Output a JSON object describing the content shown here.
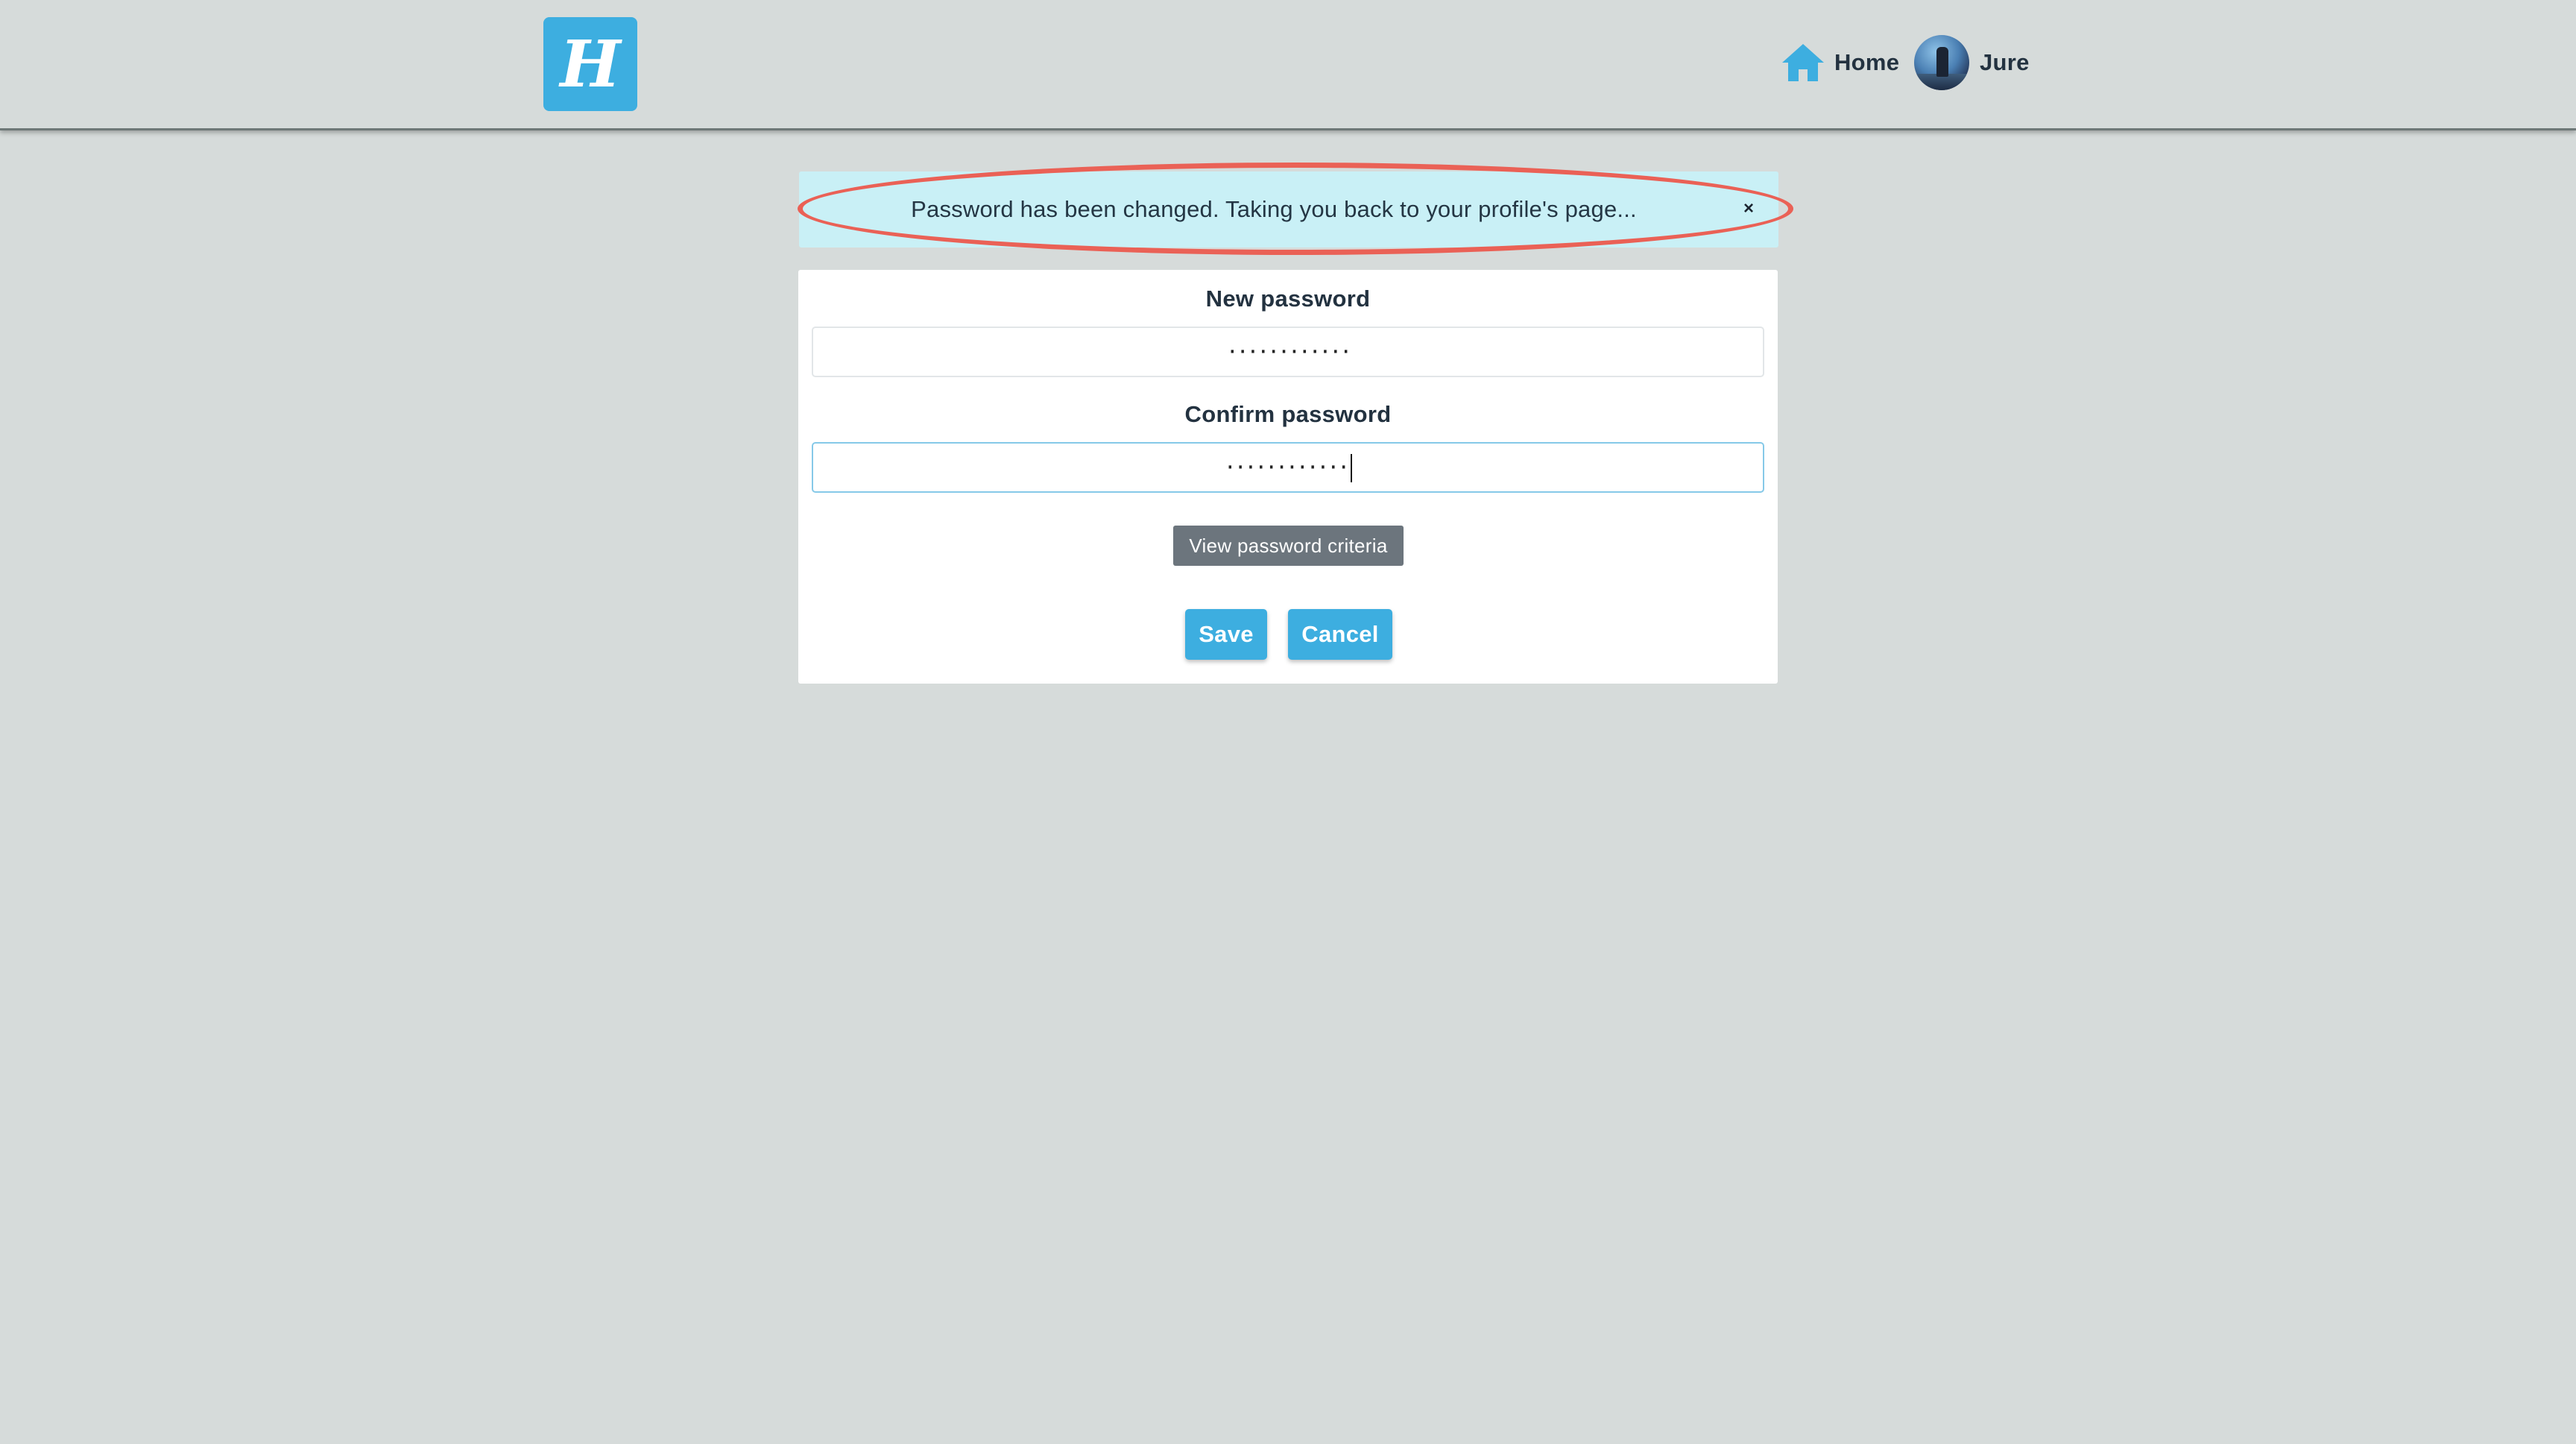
{
  "header": {
    "logo_letter": "H",
    "nav": {
      "home_label": "Home",
      "user_name": "Jure"
    }
  },
  "alert": {
    "message": "Password has been changed. Taking you back to your profile's page...",
    "close_symbol": "×"
  },
  "form": {
    "new_password": {
      "label": "New password",
      "value": "············"
    },
    "confirm_password": {
      "label": "Confirm password",
      "value": "············"
    },
    "criteria_button_label": "View password criteria",
    "save_label": "Save",
    "cancel_label": "Cancel"
  },
  "colors": {
    "page_background": "#d6dbda",
    "accent": "#3daee0",
    "alert_background": "#c9f0f6",
    "highlight_outline": "#ea6156",
    "secondary_button": "#6c757d"
  },
  "icons": {
    "logo": "h-logo-icon",
    "home": "home-icon",
    "close": "close-icon"
  }
}
